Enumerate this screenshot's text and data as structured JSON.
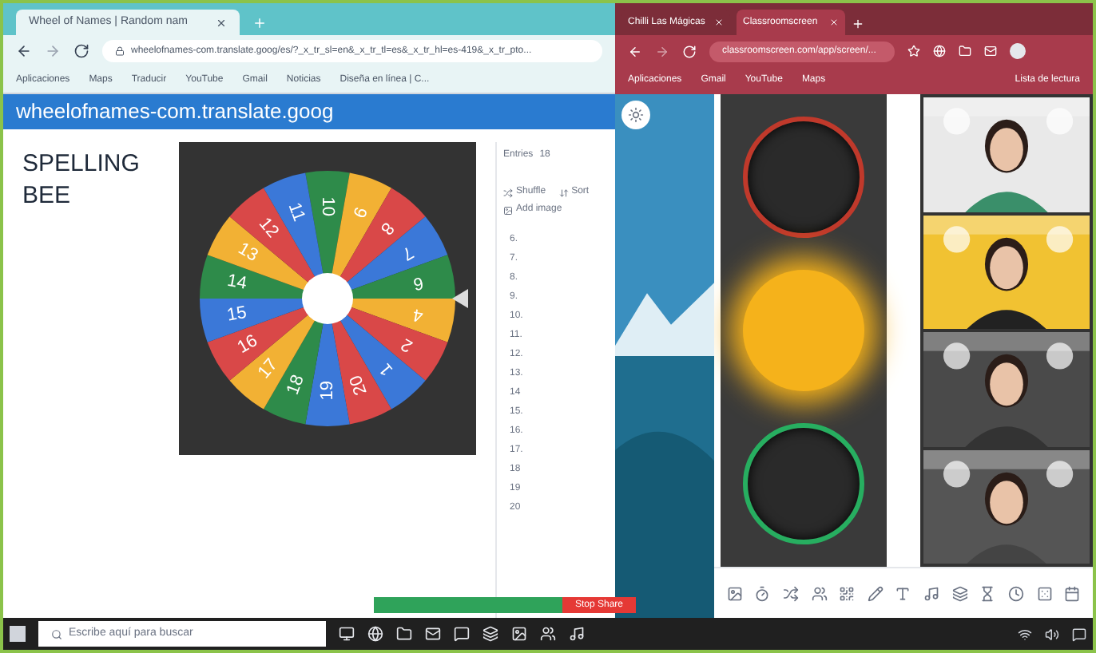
{
  "left_browser": {
    "tabs": [
      {
        "title": "Wheel of Names | Random nam",
        "selected": true
      }
    ],
    "address": "wheelofnames-com.translate.goog/es/?_x_tr_sl=en&_x_tr_tl=es&_x_tr_hl=es-419&_x_tr_pto...",
    "bookmarks": [
      "Aplicaciones",
      "Maps",
      "Traducir",
      "YouTube",
      "Gmail",
      "Noticias",
      "Diseña en línea | C..."
    ],
    "banner": "wheelofnames-com.translate.goog",
    "title_lines": [
      "SPELLING",
      "BEE"
    ],
    "wheel": {
      "segments": [
        {
          "label": "10",
          "color": "#2e8b4a"
        },
        {
          "label": "9",
          "color": "#f2b134"
        },
        {
          "label": "8",
          "color": "#d94848"
        },
        {
          "label": "7",
          "color": "#3b78d8"
        },
        {
          "label": "6",
          "color": "#2e8b4a"
        },
        {
          "label": "4",
          "color": "#f2b134"
        },
        {
          "label": "2",
          "color": "#d94848"
        },
        {
          "label": "1",
          "color": "#3b78d8"
        },
        {
          "label": "20",
          "color": "#d94848"
        },
        {
          "label": "19",
          "color": "#3b78d8"
        },
        {
          "label": "18",
          "color": "#2e8b4a"
        },
        {
          "label": "17",
          "color": "#f2b134"
        },
        {
          "label": "16",
          "color": "#d94848"
        },
        {
          "label": "15",
          "color": "#3b78d8"
        },
        {
          "label": "14",
          "color": "#2e8b4a"
        },
        {
          "label": "13",
          "color": "#f2b134"
        },
        {
          "label": "12",
          "color": "#d94848"
        },
        {
          "label": "11",
          "color": "#3b78d8"
        }
      ]
    },
    "entries_panel": {
      "count_label": "Entries",
      "count": "18",
      "shuffle": "Shuffle",
      "sort": "Sort",
      "add_image": "Add image",
      "entries": [
        "6.",
        "7.",
        "8.",
        "9.",
        "10.",
        "11.",
        "12.",
        "13.",
        "14",
        "15.",
        "16.",
        "17.",
        "18",
        "19",
        "20"
      ]
    }
  },
  "right_browser": {
    "tabs": [
      {
        "title": "Chilli Las Mágicas",
        "selected": false
      },
      {
        "title": "Classroomscreen",
        "selected": true
      }
    ],
    "address": "classroomscreen.com/app/screen/...",
    "bookmarks": [
      "Aplicaciones",
      "Gmail",
      "YouTube",
      "Maps"
    ],
    "reading_list": "Lista de lectura",
    "traffic_light": {
      "lights": [
        {
          "color": "#c0392b",
          "lit": false
        },
        {
          "color": "#f5b21b",
          "lit": true
        },
        {
          "color": "#27ae60",
          "lit": false
        }
      ]
    }
  },
  "share_bar": {
    "stop": "Stop Share"
  },
  "taskbar": {
    "search_placeholder": "Escribe aquí para buscar"
  }
}
